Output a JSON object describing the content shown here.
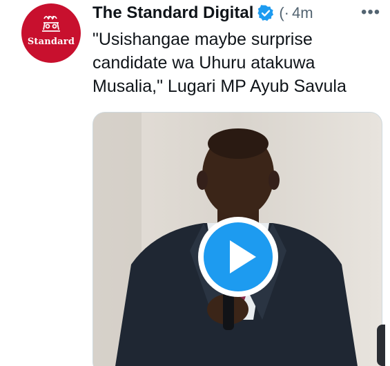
{
  "tweet": {
    "author_name": "The Standard Digital",
    "avatar_label": "Standard",
    "handle_fragment": "(·",
    "time": "4m",
    "more_icon": "more-horizontal-icon",
    "verified_icon": "verified-badge-icon",
    "text": "\"Usishangae maybe surprise candidate wa Uhuru atakuwa Musalia,\" Lugari MP Ayub Savula"
  },
  "media": {
    "type": "video",
    "play_icon": "play-icon"
  },
  "colors": {
    "brand_red": "#c8102e",
    "verified_blue": "#1d9bf0",
    "text_primary": "#0f1419",
    "text_secondary": "#536471"
  }
}
